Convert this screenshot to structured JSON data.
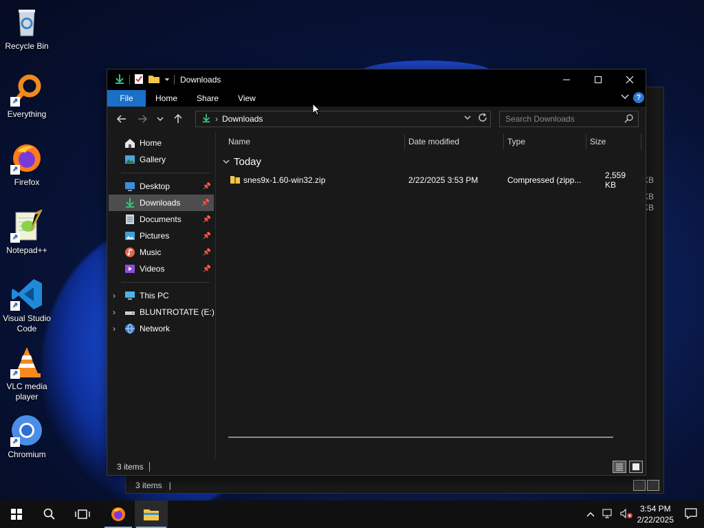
{
  "desktop": {
    "icons": [
      {
        "label": "Recycle Bin",
        "icon": "recycle-bin-icon"
      },
      {
        "label": "Everything",
        "icon": "everything-icon"
      },
      {
        "label": "Firefox",
        "icon": "firefox-icon"
      },
      {
        "label": "Notepad++",
        "icon": "notepad-plus-plus-icon"
      },
      {
        "label": "Visual Studio Code",
        "icon": "vscode-icon"
      },
      {
        "label": "VLC media player",
        "icon": "vlc-icon"
      },
      {
        "label": "Chromium",
        "icon": "chromium-icon"
      }
    ]
  },
  "background_window": {
    "status": "3 items",
    "sizes": [
      "KB",
      "KB",
      "KB"
    ]
  },
  "window": {
    "title": "Downloads",
    "ribbon_tabs": {
      "file": "File",
      "home": "Home",
      "share": "Share",
      "view": "View"
    },
    "address": {
      "current": "Downloads",
      "separator": "›"
    },
    "search": {
      "placeholder": "Search Downloads"
    },
    "nav": {
      "home": "Home",
      "gallery": "Gallery",
      "desktop": "Desktop",
      "downloads": "Downloads",
      "documents": "Documents",
      "pictures": "Pictures",
      "music": "Music",
      "videos": "Videos",
      "this_pc": "This PC",
      "drive": "BLUNTROTATE (E:)",
      "network": "Network"
    },
    "columns": {
      "name": "Name",
      "date": "Date modified",
      "type": "Type",
      "size": "Size"
    },
    "group": "Today",
    "files": [
      {
        "name": "snes9x-1.60-win32.zip",
        "date": "2/22/2025 3:53 PM",
        "type": "Compressed (zipp...",
        "size": "2,559 KB"
      }
    ],
    "status": "3 items"
  },
  "taskbar": {
    "time": "3:54 PM",
    "date": "2/22/2025"
  },
  "colors": {
    "accent": "#1a6fc9",
    "window_bg": "#191919",
    "selected": "#4d4d4d",
    "download_green": "#3fbf7f"
  }
}
